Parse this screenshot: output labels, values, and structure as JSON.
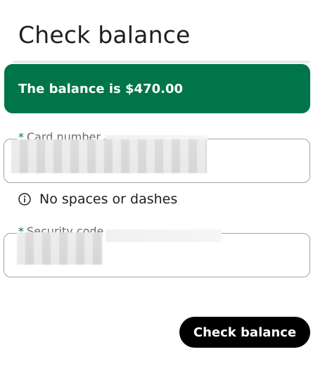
{
  "page": {
    "title": "Check balance"
  },
  "banner": {
    "message": "The balance is $470.00",
    "color": "#00754a"
  },
  "form": {
    "card_number": {
      "required_marker": "*",
      "label": "Card number",
      "value": ""
    },
    "helper": {
      "icon": "info-icon",
      "text": "No spaces or dashes"
    },
    "security_code": {
      "required_marker": "*",
      "label": "Security code",
      "value": ""
    },
    "submit_label": "Check balance"
  }
}
